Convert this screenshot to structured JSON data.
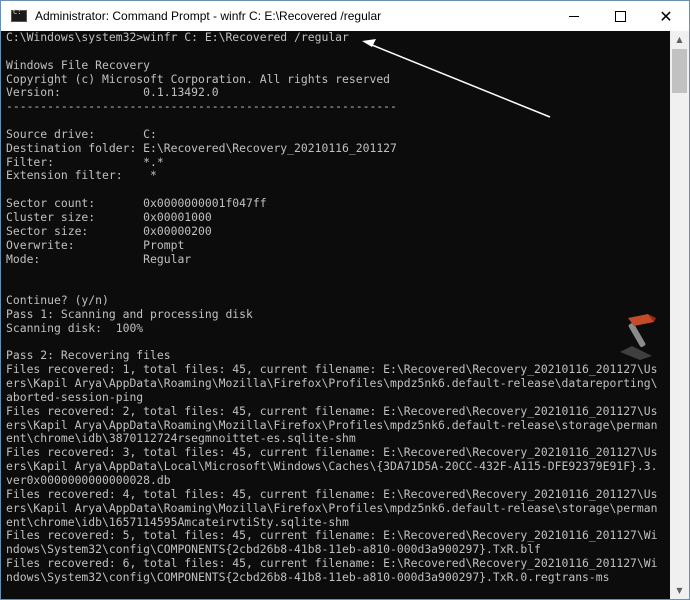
{
  "window": {
    "title": "Administrator: Command Prompt - winfr  C: E:\\Recovered /regular",
    "close_glyph": "✕",
    "scroll_up_glyph": "▲",
    "scroll_down_glyph": "▼"
  },
  "console": {
    "prompt": "C:\\Windows\\system32>",
    "command": "winfr C: E:\\Recovered /regular",
    "output": "\nWindows File Recovery\nCopyright (c) Microsoft Corporation. All rights reserved\nVersion:            0.1.13492.0\n---------------------------------------------------------\n\nSource drive:       C:\nDestination folder: E:\\Recovered\\Recovery_20210116_201127\nFilter:             *.*\nExtension filter:    *\n\nSector count:       0x0000000001f047ff\nCluster size:       0x00001000\nSector size:        0x00000200\nOverwrite:          Prompt\nMode:               Regular\n\n\nContinue? (y/n)\nPass 1: Scanning and processing disk\nScanning disk:  100%\n\nPass 2: Recovering files\nFiles recovered: 1, total files: 45, current filename: E:\\Recovered\\Recovery_20210116_201127\\Us\ners\\Kapil Arya\\AppData\\Roaming\\Mozilla\\Firefox\\Profiles\\mpdz5nk6.default-release\\datareporting\\\naborted-session-ping\nFiles recovered: 2, total files: 45, current filename: E:\\Recovered\\Recovery_20210116_201127\\Us\ners\\Kapil Arya\\AppData\\Roaming\\Mozilla\\Firefox\\Profiles\\mpdz5nk6.default-release\\storage\\perman\nent\\chrome\\idb\\3870112724rsegmnoittet-es.sqlite-shm\nFiles recovered: 3, total files: 45, current filename: E:\\Recovered\\Recovery_20210116_201127\\Us\ners\\Kapil Arya\\AppData\\Local\\Microsoft\\Windows\\Caches\\{3DA71D5A-20CC-432F-A115-DFE92379E91F}.3.\nver0x0000000000000028.db\nFiles recovered: 4, total files: 45, current filename: E:\\Recovered\\Recovery_20210116_201127\\Us\ners\\Kapil Arya\\AppData\\Roaming\\Mozilla\\Firefox\\Profiles\\mpdz5nk6.default-release\\storage\\perman\nent\\chrome\\idb\\1657114595AmcateirvtiSty.sqlite-shm\nFiles recovered: 5, total files: 45, current filename: E:\\Recovered\\Recovery_20210116_201127\\Wi\nndows\\System32\\config\\COMPONENTS{2cbd26b8-41b8-11eb-a810-000d3a900297}.TxR.blf\nFiles recovered: 6, total files: 45, current filename: E:\\Recovered\\Recovery_20210116_201127\\Wi\nndows\\System32\\config\\COMPONENTS{2cbd26b8-41b8-11eb-a810-000d3a900297}.TxR.0.regtrans-ms"
  },
  "colors": {
    "console_bg": "#0c0c0c",
    "console_text": "#c0c0c0",
    "annotation_arrow": "#ffffff"
  }
}
